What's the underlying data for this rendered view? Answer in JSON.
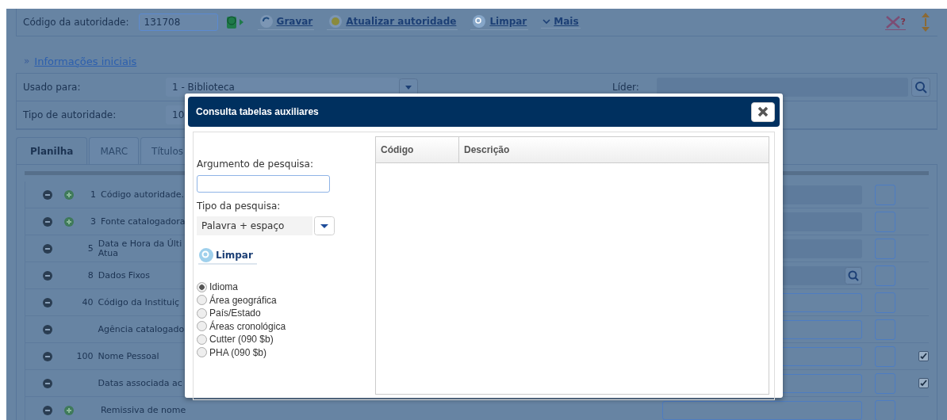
{
  "toolbar": {
    "code_label": "Código da autoridade:",
    "code_value": "131708",
    "actions": [
      {
        "kind": "save",
        "label": "Gravar"
      },
      {
        "kind": "update",
        "label": "Atualizar autoridade"
      },
      {
        "kind": "clear",
        "label": "Limpar"
      },
      {
        "kind": "more",
        "label": "Mais"
      }
    ],
    "help_mark": "?"
  },
  "section": {
    "title": "Informações iniciais",
    "marker": "»"
  },
  "fields": [
    {
      "label": "Usado para:",
      "value": "1 - Biblioteca"
    },
    {
      "label": "Tipo de autoridade:",
      "value": "10"
    }
  ],
  "leader": {
    "label": "Líder:"
  },
  "tabs": [
    {
      "label": "Planilha",
      "selected": true
    },
    {
      "label": "MARC",
      "selected": false
    },
    {
      "label": "Títulos",
      "selected": false
    }
  ],
  "rows": [
    {
      "plus": true,
      "number": "1",
      "label": "Código autoridade.",
      "kind": "readonly"
    },
    {
      "plus": true,
      "number": "3",
      "label": "Fonte catalogadora",
      "kind": "readonly"
    },
    {
      "plus": false,
      "number": "5",
      "label": "Data e Hora da Últi\nAtua",
      "kind": "readonly"
    },
    {
      "plus": false,
      "number": "8",
      "label": "Dados Fixos",
      "kind": "lookup"
    },
    {
      "plus": false,
      "number": "40",
      "label": "Código da Instituiç",
      "kind": "input"
    },
    {
      "plus": false,
      "number": "",
      "label": "Agência catalogado",
      "kind": "input"
    },
    {
      "plus": false,
      "number": "100",
      "label": "Nome Pessoal",
      "kind": "input",
      "flag": {
        "checked": true
      }
    },
    {
      "plus": false,
      "number": "",
      "label": "Datas associada ac",
      "kind": "input",
      "flag": {
        "checked": true
      }
    },
    {
      "plus": true,
      "number": "",
      "label": "Remissiva de nome",
      "kind": "input"
    }
  ],
  "dialog": {
    "title": "Consulta tabelas auxiliares",
    "search_label": "Argumento de pesquisa:",
    "type_label": "Tipo da pesquisa:",
    "type_value": "Palavra + espaço",
    "clear_label": "Limpar",
    "options": [
      {
        "label": "Idioma",
        "selected": true
      },
      {
        "label": "Área geográfica",
        "selected": false
      },
      {
        "label": "País/Estado",
        "selected": false
      },
      {
        "label": "Áreas cronológica",
        "selected": false
      },
      {
        "label": "Cutter (090 $b)",
        "selected": false
      },
      {
        "label": "PHA (090 $b)",
        "selected": false
      }
    ],
    "columns": [
      "Código",
      "Descrição"
    ]
  }
}
